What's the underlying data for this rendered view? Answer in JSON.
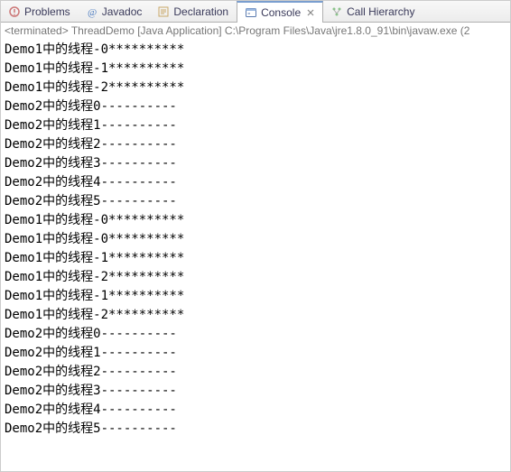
{
  "tabs": [
    {
      "label": "Problems"
    },
    {
      "label": "Javadoc"
    },
    {
      "label": "Declaration"
    },
    {
      "label": "Console"
    },
    {
      "label": "Call Hierarchy"
    }
  ],
  "status": "<terminated> ThreadDemo [Java Application] C:\\Program Files\\Java\\jre1.8.0_91\\bin\\javaw.exe (2",
  "output": [
    "Demo1中的线程-0**********",
    "Demo1中的线程-1**********",
    "Demo1中的线程-2**********",
    "Demo2中的线程0----------",
    "Demo2中的线程1----------",
    "Demo2中的线程2----------",
    "Demo2中的线程3----------",
    "Demo2中的线程4----------",
    "Demo2中的线程5----------",
    "Demo1中的线程-0**********",
    "Demo1中的线程-0**********",
    "Demo1中的线程-1**********",
    "Demo1中的线程-2**********",
    "Demo1中的线程-1**********",
    "Demo1中的线程-2**********",
    "Demo2中的线程0----------",
    "Demo2中的线程1----------",
    "Demo2中的线程2----------",
    "Demo2中的线程3----------",
    "Demo2中的线程4----------",
    "Demo2中的线程5----------"
  ]
}
